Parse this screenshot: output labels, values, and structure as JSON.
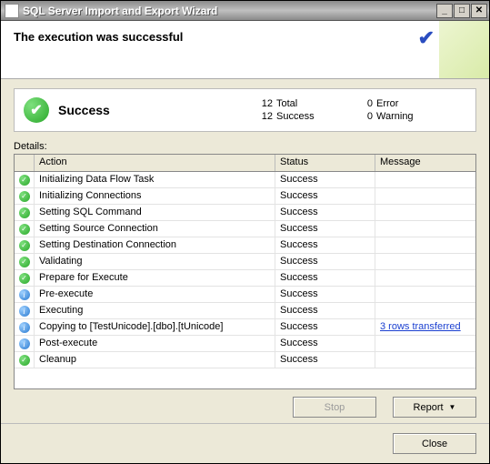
{
  "window": {
    "title": "SQL Server Import and Export Wizard"
  },
  "header": {
    "message": "The execution was successful"
  },
  "summary": {
    "label": "Success",
    "total_n": "12",
    "total_label": "Total",
    "success_n": "12",
    "success_label": "Success",
    "error_n": "0",
    "error_label": "Error",
    "warning_n": "0",
    "warning_label": "Warning"
  },
  "details_label": "Details:",
  "columns": {
    "icon": "",
    "action": "Action",
    "status": "Status",
    "message": "Message"
  },
  "rows": [
    {
      "icon": "success",
      "action": "Initializing Data Flow Task",
      "status": "Success",
      "message": ""
    },
    {
      "icon": "success",
      "action": "Initializing Connections",
      "status": "Success",
      "message": ""
    },
    {
      "icon": "success",
      "action": "Setting SQL Command",
      "status": "Success",
      "message": ""
    },
    {
      "icon": "success",
      "action": "Setting Source Connection",
      "status": "Success",
      "message": ""
    },
    {
      "icon": "success",
      "action": "Setting Destination Connection",
      "status": "Success",
      "message": ""
    },
    {
      "icon": "success",
      "action": "Validating",
      "status": "Success",
      "message": ""
    },
    {
      "icon": "success",
      "action": "Prepare for Execute",
      "status": "Success",
      "message": ""
    },
    {
      "icon": "info",
      "action": "Pre-execute",
      "status": "Success",
      "message": ""
    },
    {
      "icon": "info",
      "action": "Executing",
      "status": "Success",
      "message": ""
    },
    {
      "icon": "info",
      "action": "Copying to [TestUnicode].[dbo].[tUnicode]",
      "status": "Success",
      "message": "3 rows transferred",
      "link": true
    },
    {
      "icon": "info",
      "action": "Post-execute",
      "status": "Success",
      "message": ""
    },
    {
      "icon": "success",
      "action": "Cleanup",
      "status": "Success",
      "message": ""
    }
  ],
  "buttons": {
    "stop": "Stop",
    "report": "Report",
    "close": "Close"
  }
}
